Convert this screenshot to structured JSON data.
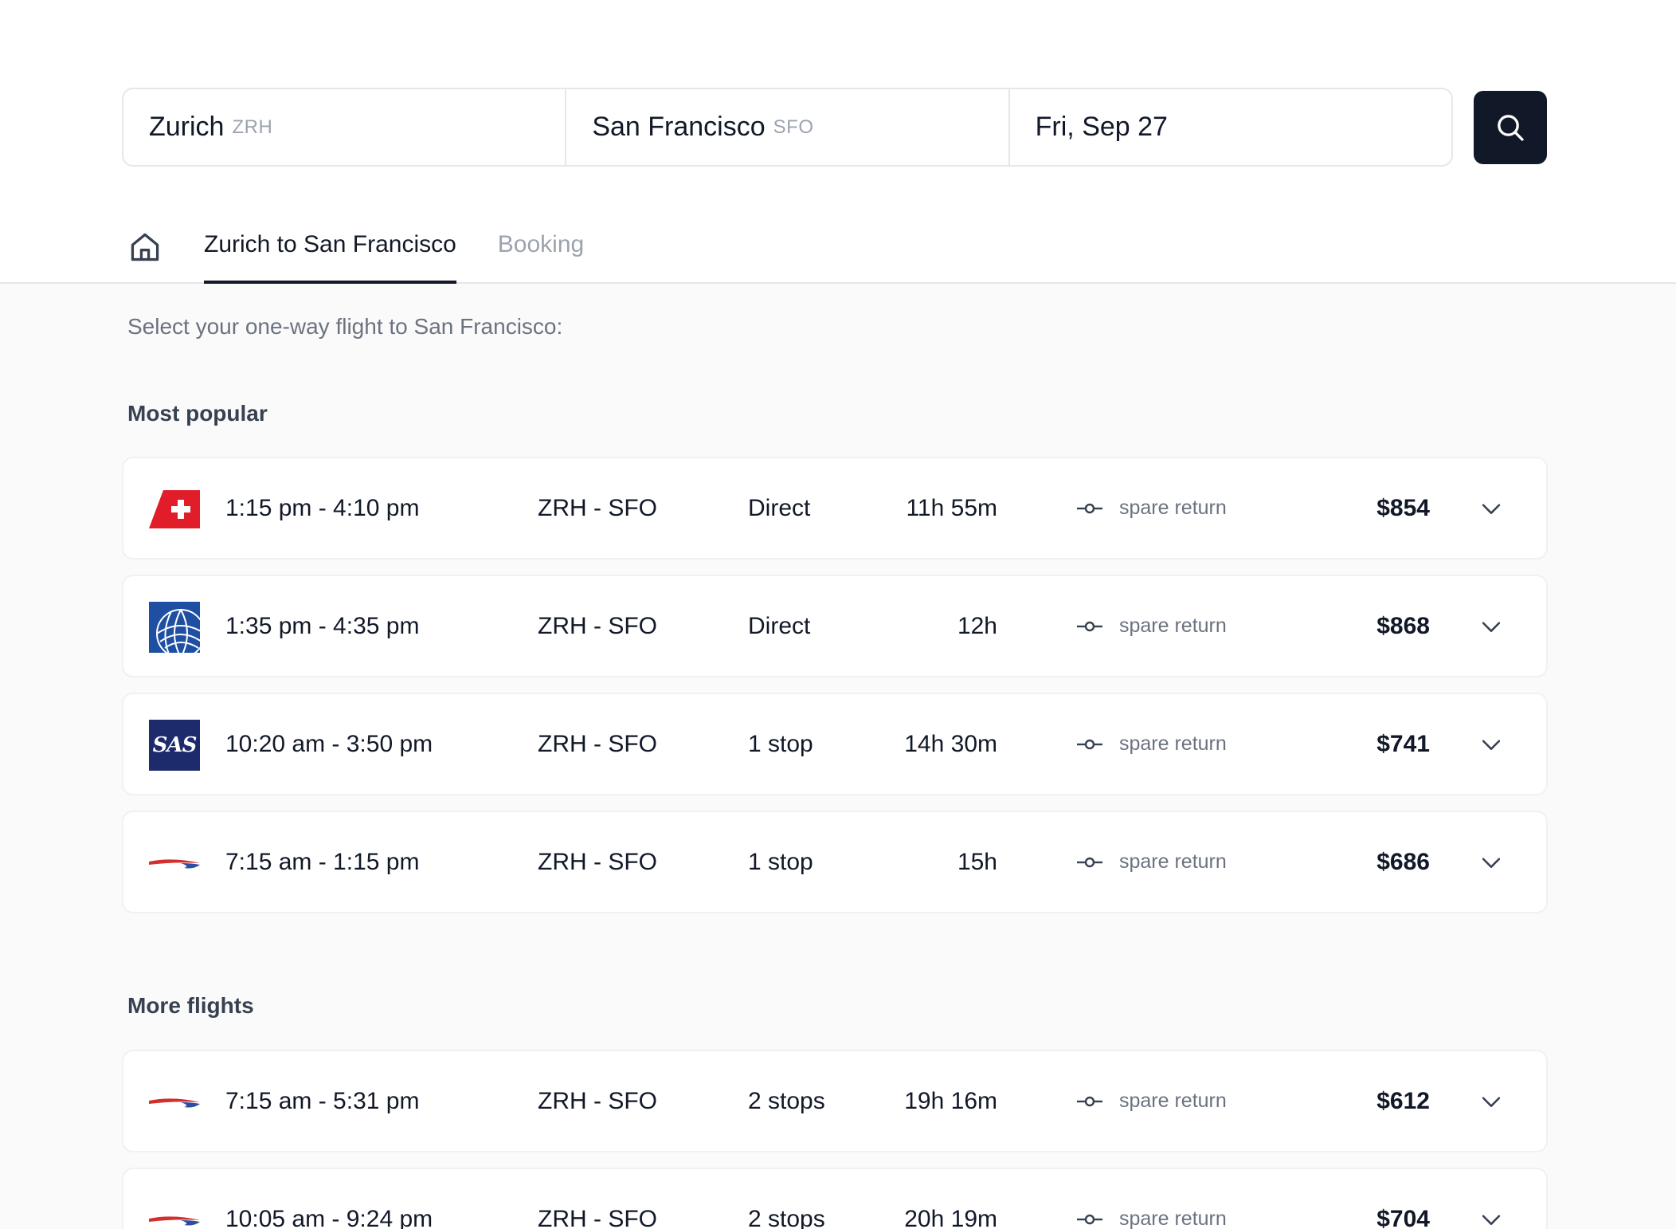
{
  "search": {
    "origin_city": "Zurich",
    "origin_code": "ZRH",
    "destination_city": "San Francisco",
    "destination_code": "SFO",
    "date": "Fri, Sep 27"
  },
  "tabs": [
    {
      "label": "Zurich to San Francisco",
      "active": true
    },
    {
      "label": "Booking",
      "active": false
    }
  ],
  "subtitle": "Select your one-way flight to San Francisco:",
  "sections": {
    "popular_title": "Most popular",
    "more_title": "More flights"
  },
  "popular_flights": [
    {
      "airline_icon": "swiss-logo-icon",
      "time": "1:15 pm - 4:10 pm",
      "route": "ZRH - SFO",
      "stops": "Direct",
      "duration": "11h 55m",
      "spare": "spare return",
      "price": "$854"
    },
    {
      "airline_icon": "united-logo-icon",
      "time": "1:35 pm - 4:35 pm",
      "route": "ZRH - SFO",
      "stops": "Direct",
      "duration": "12h",
      "spare": "spare return",
      "price": "$868"
    },
    {
      "airline_icon": "sas-logo-icon",
      "time": "10:20 am - 3:50 pm",
      "route": "ZRH - SFO",
      "stops": "1 stop",
      "duration": "14h 30m",
      "spare": "spare return",
      "price": "$741"
    },
    {
      "airline_icon": "british-airways-logo-icon",
      "time": "7:15 am - 1:15 pm",
      "route": "ZRH - SFO",
      "stops": "1 stop",
      "duration": "15h",
      "spare": "spare return",
      "price": "$686"
    }
  ],
  "more_flights": [
    {
      "airline_icon": "british-airways-logo-icon",
      "time": "7:15 am - 5:31 pm",
      "route": "ZRH - SFO",
      "stops": "2 stops",
      "duration": "19h 16m",
      "spare": "spare return",
      "price": "$612"
    },
    {
      "airline_icon": "british-airways-logo-icon",
      "time": "10:05 am - 9:24 pm",
      "route": "ZRH - SFO",
      "stops": "2 stops",
      "duration": "20h 19m",
      "spare": "spare return",
      "price": "$704"
    }
  ],
  "logo_text": {
    "sas": "SAS"
  },
  "colors": {
    "search_button": "#111827",
    "swiss_red": "#e11d2a",
    "united_blue": "#1e4fa3",
    "sas_navy": "#1d2a6b",
    "ba_red": "#d32f2f",
    "ba_blue": "#2b4f9e"
  }
}
